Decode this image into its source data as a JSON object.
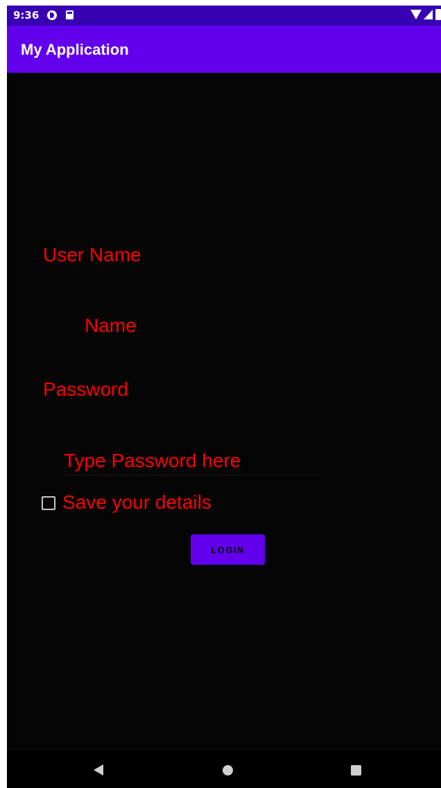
{
  "status_bar": {
    "time": "9:36",
    "icons": [
      "cast-icon",
      "sd-card-icon",
      "wifi-icon",
      "signal-icon",
      "battery-icon"
    ]
  },
  "app_bar": {
    "title": "My Application",
    "color": "#6200ee"
  },
  "form": {
    "username_label": "User Name",
    "name_placeholder": "Name",
    "password_label": "Password",
    "password_placeholder": "Type Password here",
    "save_details_label": "Save your details",
    "save_details_checked": false,
    "login_button_label": "LOGIN",
    "text_color": "#ff0000"
  },
  "nav_bar": {
    "icons": [
      "back-icon",
      "home-icon",
      "recents-icon"
    ]
  }
}
